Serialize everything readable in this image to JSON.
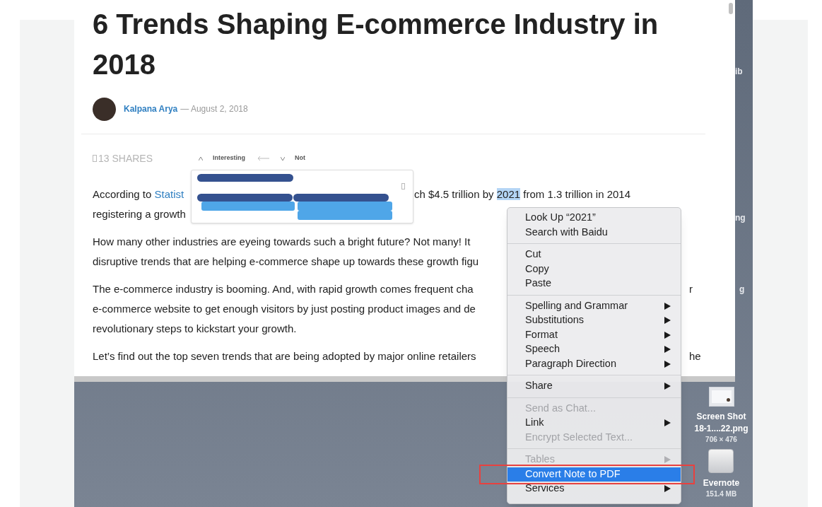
{
  "article": {
    "title": "6 Trends Shaping E-commerce Industry in 2018",
    "author": "Kalpana Arya",
    "date": "— August 2, 2018",
    "shares": "13 SHARES",
    "reactions": [
      "Interesting",
      "Not"
    ],
    "paragraphs": [
      {
        "lines": [
          {
            "segments": [
              {
                "kind": "text",
                "text": "According to "
              },
              {
                "kind": "link",
                "text": "Statist"
              }
            ],
            "segments_after_popup": [
              {
                "kind": "text",
                "text": "ch $4.5 trillion by "
              },
              {
                "kind": "highlight",
                "text": "2021"
              },
              {
                "kind": "text",
                "text": " from 1.3 trillion in 2014"
              }
            ]
          },
          {
            "segments": [
              {
                "kind": "text",
                "text": "registering a growth"
              }
            ]
          }
        ]
      },
      {
        "lines": [
          {
            "segments": [
              {
                "kind": "text",
                "text": "How many other industries are eyeing towards such a bright future? Not many! It"
              }
            ]
          },
          {
            "segments": [
              {
                "kind": "text",
                "text": "disruptive trends that are helping e-commerce shape up towards these growth figu"
              }
            ]
          }
        ]
      },
      {
        "lines": [
          {
            "segments": [
              {
                "kind": "text",
                "text": "The e-commerce industry is booming. And, with rapid growth comes frequent cha"
              }
            ],
            "after_menu": "r"
          },
          {
            "segments": [
              {
                "kind": "text",
                "text": "e-commerce website to get enough visitors by just posting product images and de"
              }
            ]
          },
          {
            "segments": [
              {
                "kind": "text",
                "text": "revolutionary steps to kickstart your growth."
              }
            ]
          }
        ]
      },
      {
        "lines": [
          {
            "segments": [
              {
                "kind": "text",
                "text": "Let’s find out the top seven trends that are being adopted by major online retailers"
              }
            ],
            "after_menu": "he"
          }
        ]
      }
    ]
  },
  "context_menu": {
    "items": [
      {
        "kind": "item",
        "label": "Look Up “2021”",
        "disabled": false,
        "selected": false,
        "submenu": false
      },
      {
        "kind": "item",
        "label": "Search with Baidu",
        "disabled": false,
        "selected": false,
        "submenu": false
      },
      {
        "kind": "separator"
      },
      {
        "kind": "item",
        "label": "Cut",
        "disabled": false,
        "selected": false,
        "submenu": false
      },
      {
        "kind": "item",
        "label": "Copy",
        "disabled": false,
        "selected": false,
        "submenu": false
      },
      {
        "kind": "item",
        "label": "Paste",
        "disabled": false,
        "selected": false,
        "submenu": false
      },
      {
        "kind": "separator"
      },
      {
        "kind": "item",
        "label": "Spelling and Grammar",
        "disabled": false,
        "selected": false,
        "submenu": true
      },
      {
        "kind": "item",
        "label": "Substitutions",
        "disabled": false,
        "selected": false,
        "submenu": true
      },
      {
        "kind": "item",
        "label": "Format",
        "disabled": false,
        "selected": false,
        "submenu": true
      },
      {
        "kind": "item",
        "label": "Speech",
        "disabled": false,
        "selected": false,
        "submenu": true
      },
      {
        "kind": "item",
        "label": "Paragraph Direction",
        "disabled": false,
        "selected": false,
        "submenu": true
      },
      {
        "kind": "separator"
      },
      {
        "kind": "item",
        "label": "Share",
        "disabled": false,
        "selected": false,
        "submenu": true
      },
      {
        "kind": "separator"
      },
      {
        "kind": "item",
        "label": "Send as Chat...",
        "disabled": true,
        "selected": false,
        "submenu": false
      },
      {
        "kind": "item",
        "label": "Link",
        "disabled": false,
        "selected": false,
        "submenu": true
      },
      {
        "kind": "item",
        "label": "Encrypt Selected Text...",
        "disabled": true,
        "selected": false,
        "submenu": false
      },
      {
        "kind": "separator"
      },
      {
        "kind": "item",
        "label": "Tables",
        "disabled": true,
        "selected": false,
        "submenu": true
      },
      {
        "kind": "item",
        "label": "Convert Note to PDF",
        "disabled": false,
        "selected": true,
        "submenu": false
      },
      {
        "kind": "item",
        "label": "Services",
        "disabled": false,
        "selected": false,
        "submenu": true
      }
    ]
  },
  "desktop": {
    "side_labels": [
      "ib",
      "ng",
      "g"
    ],
    "files": [
      {
        "kind": "image",
        "name_lines": [
          "Screen Shot",
          "18-1....22.png"
        ],
        "info": "706 × 476"
      },
      {
        "kind": "drive",
        "name_lines": [
          "Evernote"
        ],
        "info": "151.4 MB"
      }
    ]
  }
}
